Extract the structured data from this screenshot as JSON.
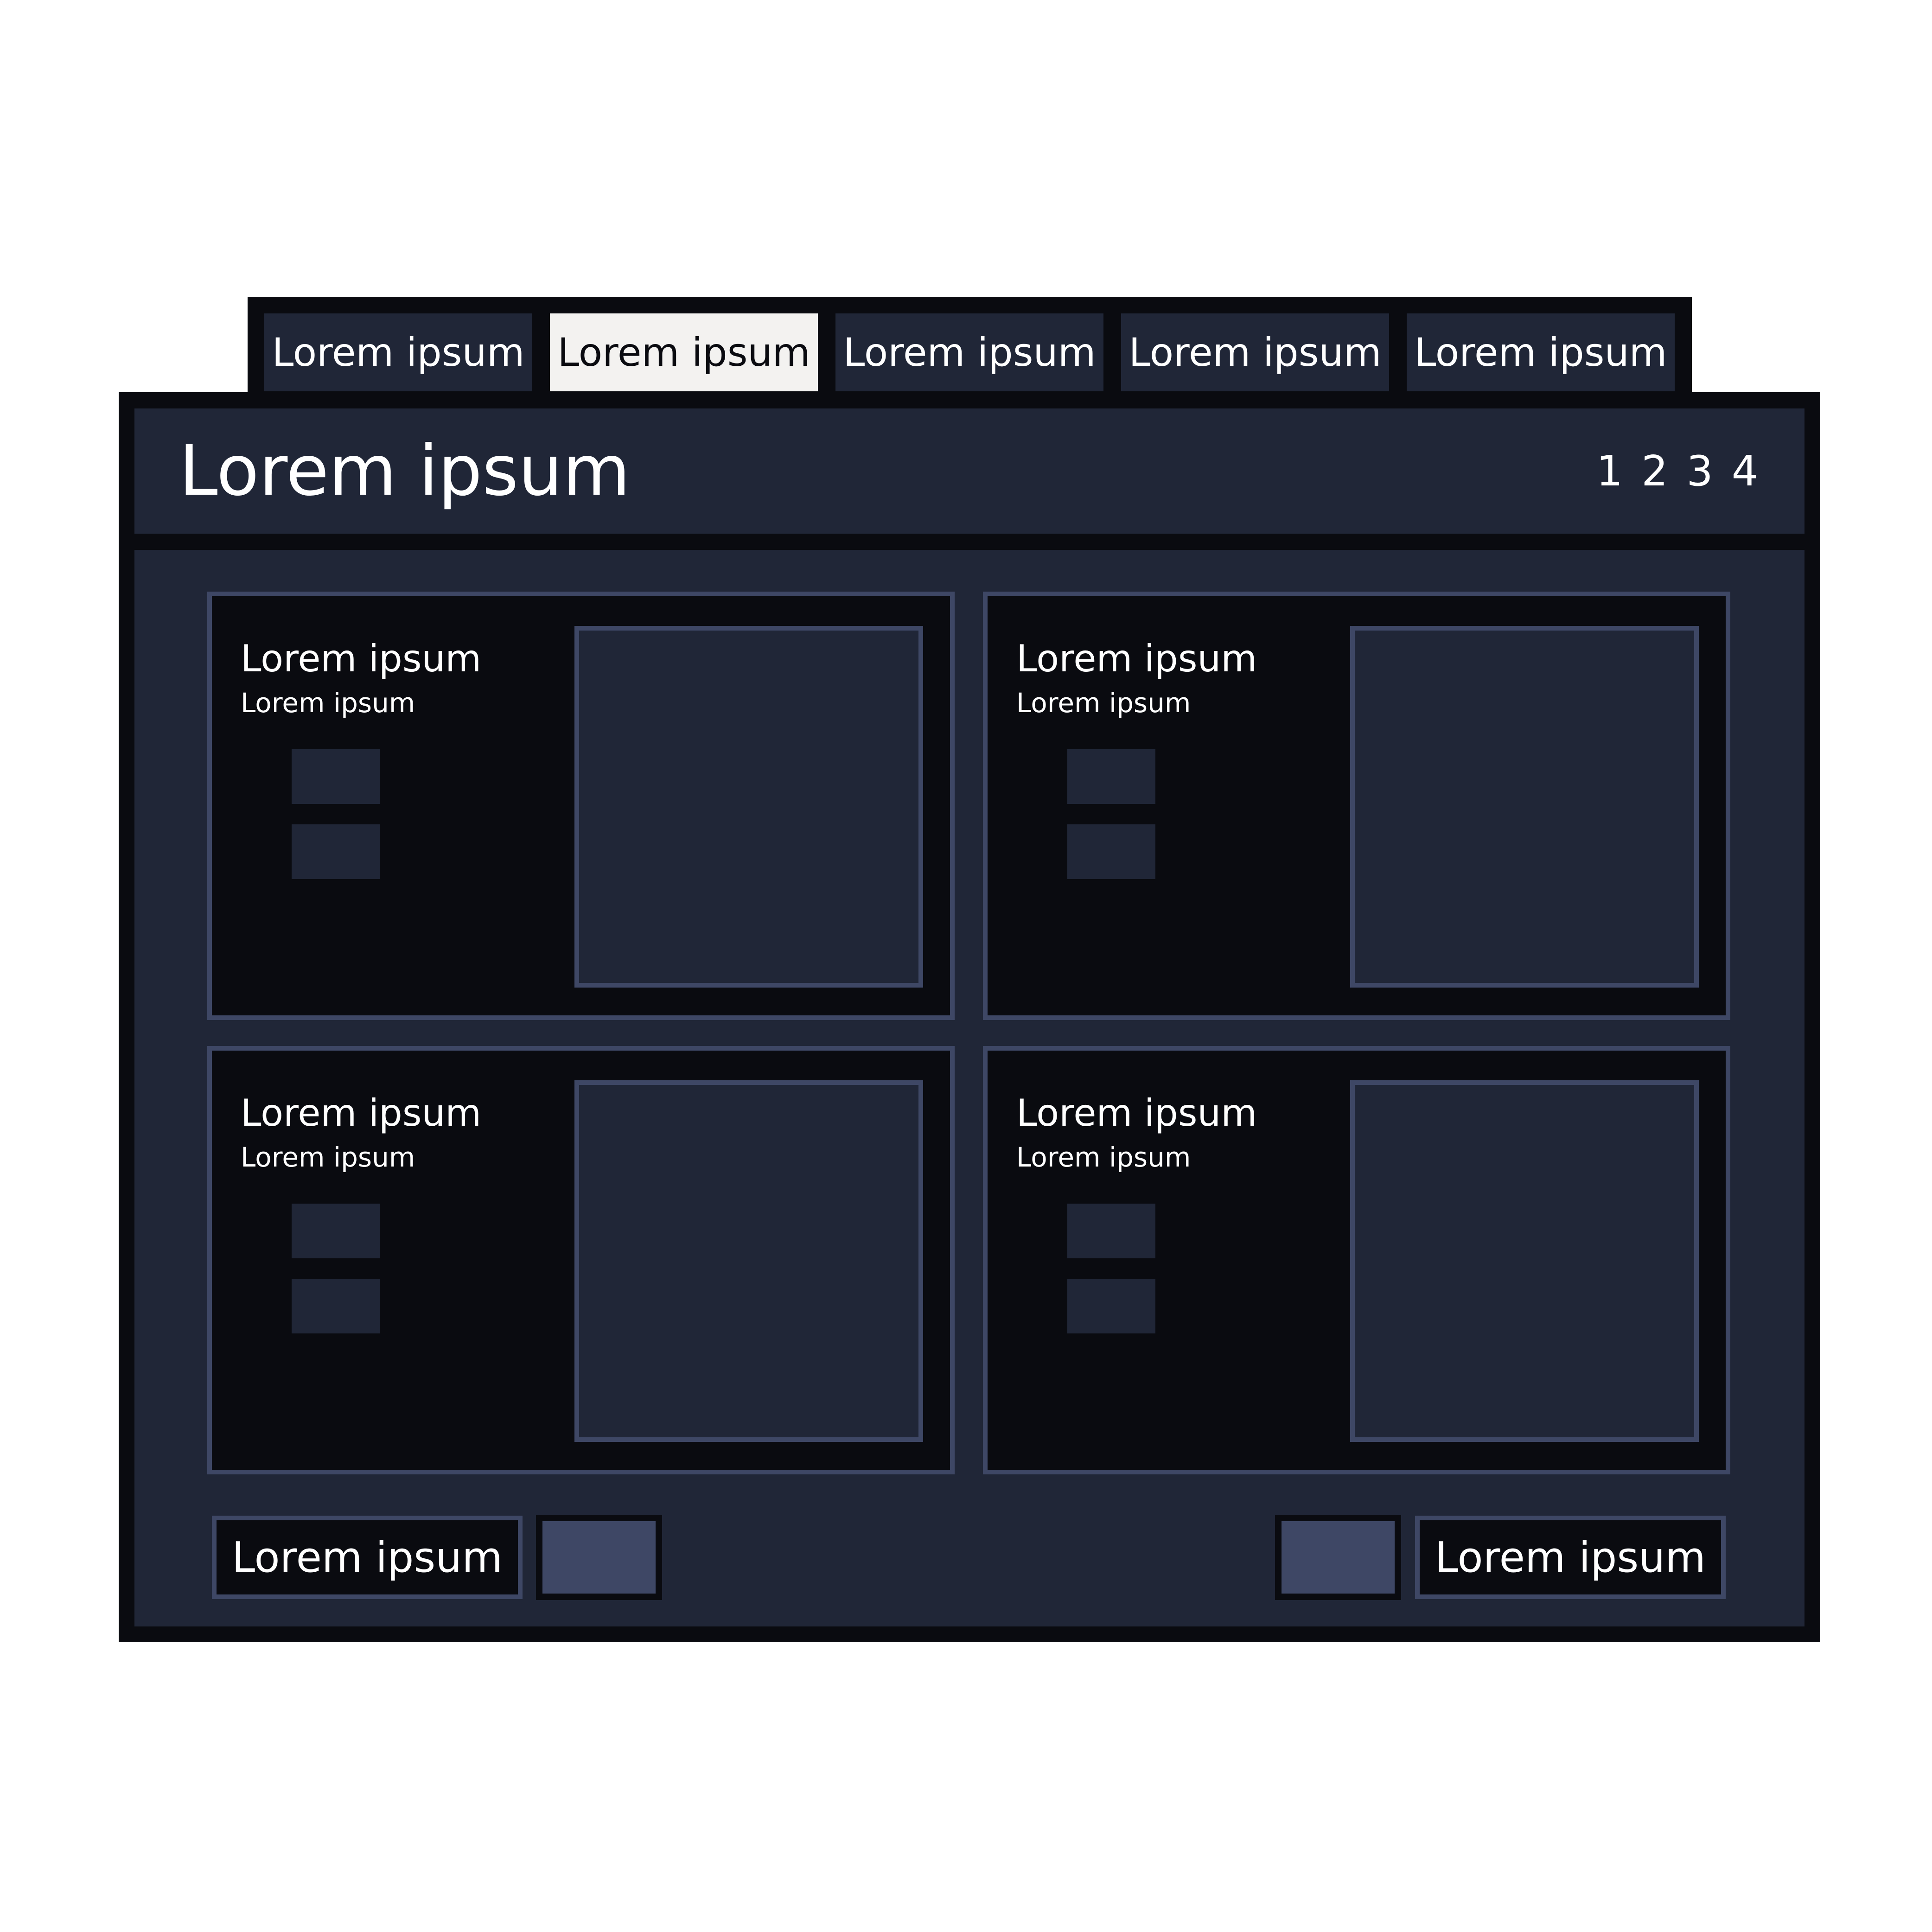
{
  "tabs": [
    {
      "label": "Lorem ipsum",
      "active": false
    },
    {
      "label": "Lorem ipsum",
      "active": true
    },
    {
      "label": "Lorem ipsum",
      "active": false
    },
    {
      "label": "Lorem ipsum",
      "active": false
    },
    {
      "label": "Lorem ipsum",
      "active": false
    }
  ],
  "header": {
    "title": "Lorem ipsum",
    "pages": [
      "1",
      "2",
      "3",
      "4"
    ]
  },
  "cards": [
    {
      "title": "Lorem ipsum",
      "subtitle": "Lorem ipsum"
    },
    {
      "title": "Lorem ipsum",
      "subtitle": "Lorem ipsum"
    },
    {
      "title": "Lorem ipsum",
      "subtitle": "Lorem ipsum"
    },
    {
      "title": "Lorem ipsum",
      "subtitle": "Lorem ipsum"
    }
  ],
  "footer": {
    "left_button_label": "Lorem ipsum",
    "right_button_label": "Lorem ipsum"
  },
  "colors": {
    "background": "#ffffff",
    "frame": "#0a0b10",
    "panel": "#202637",
    "border_accent": "#3e4765",
    "active_tab": "#f3f2f0",
    "text": "#ffffff"
  }
}
